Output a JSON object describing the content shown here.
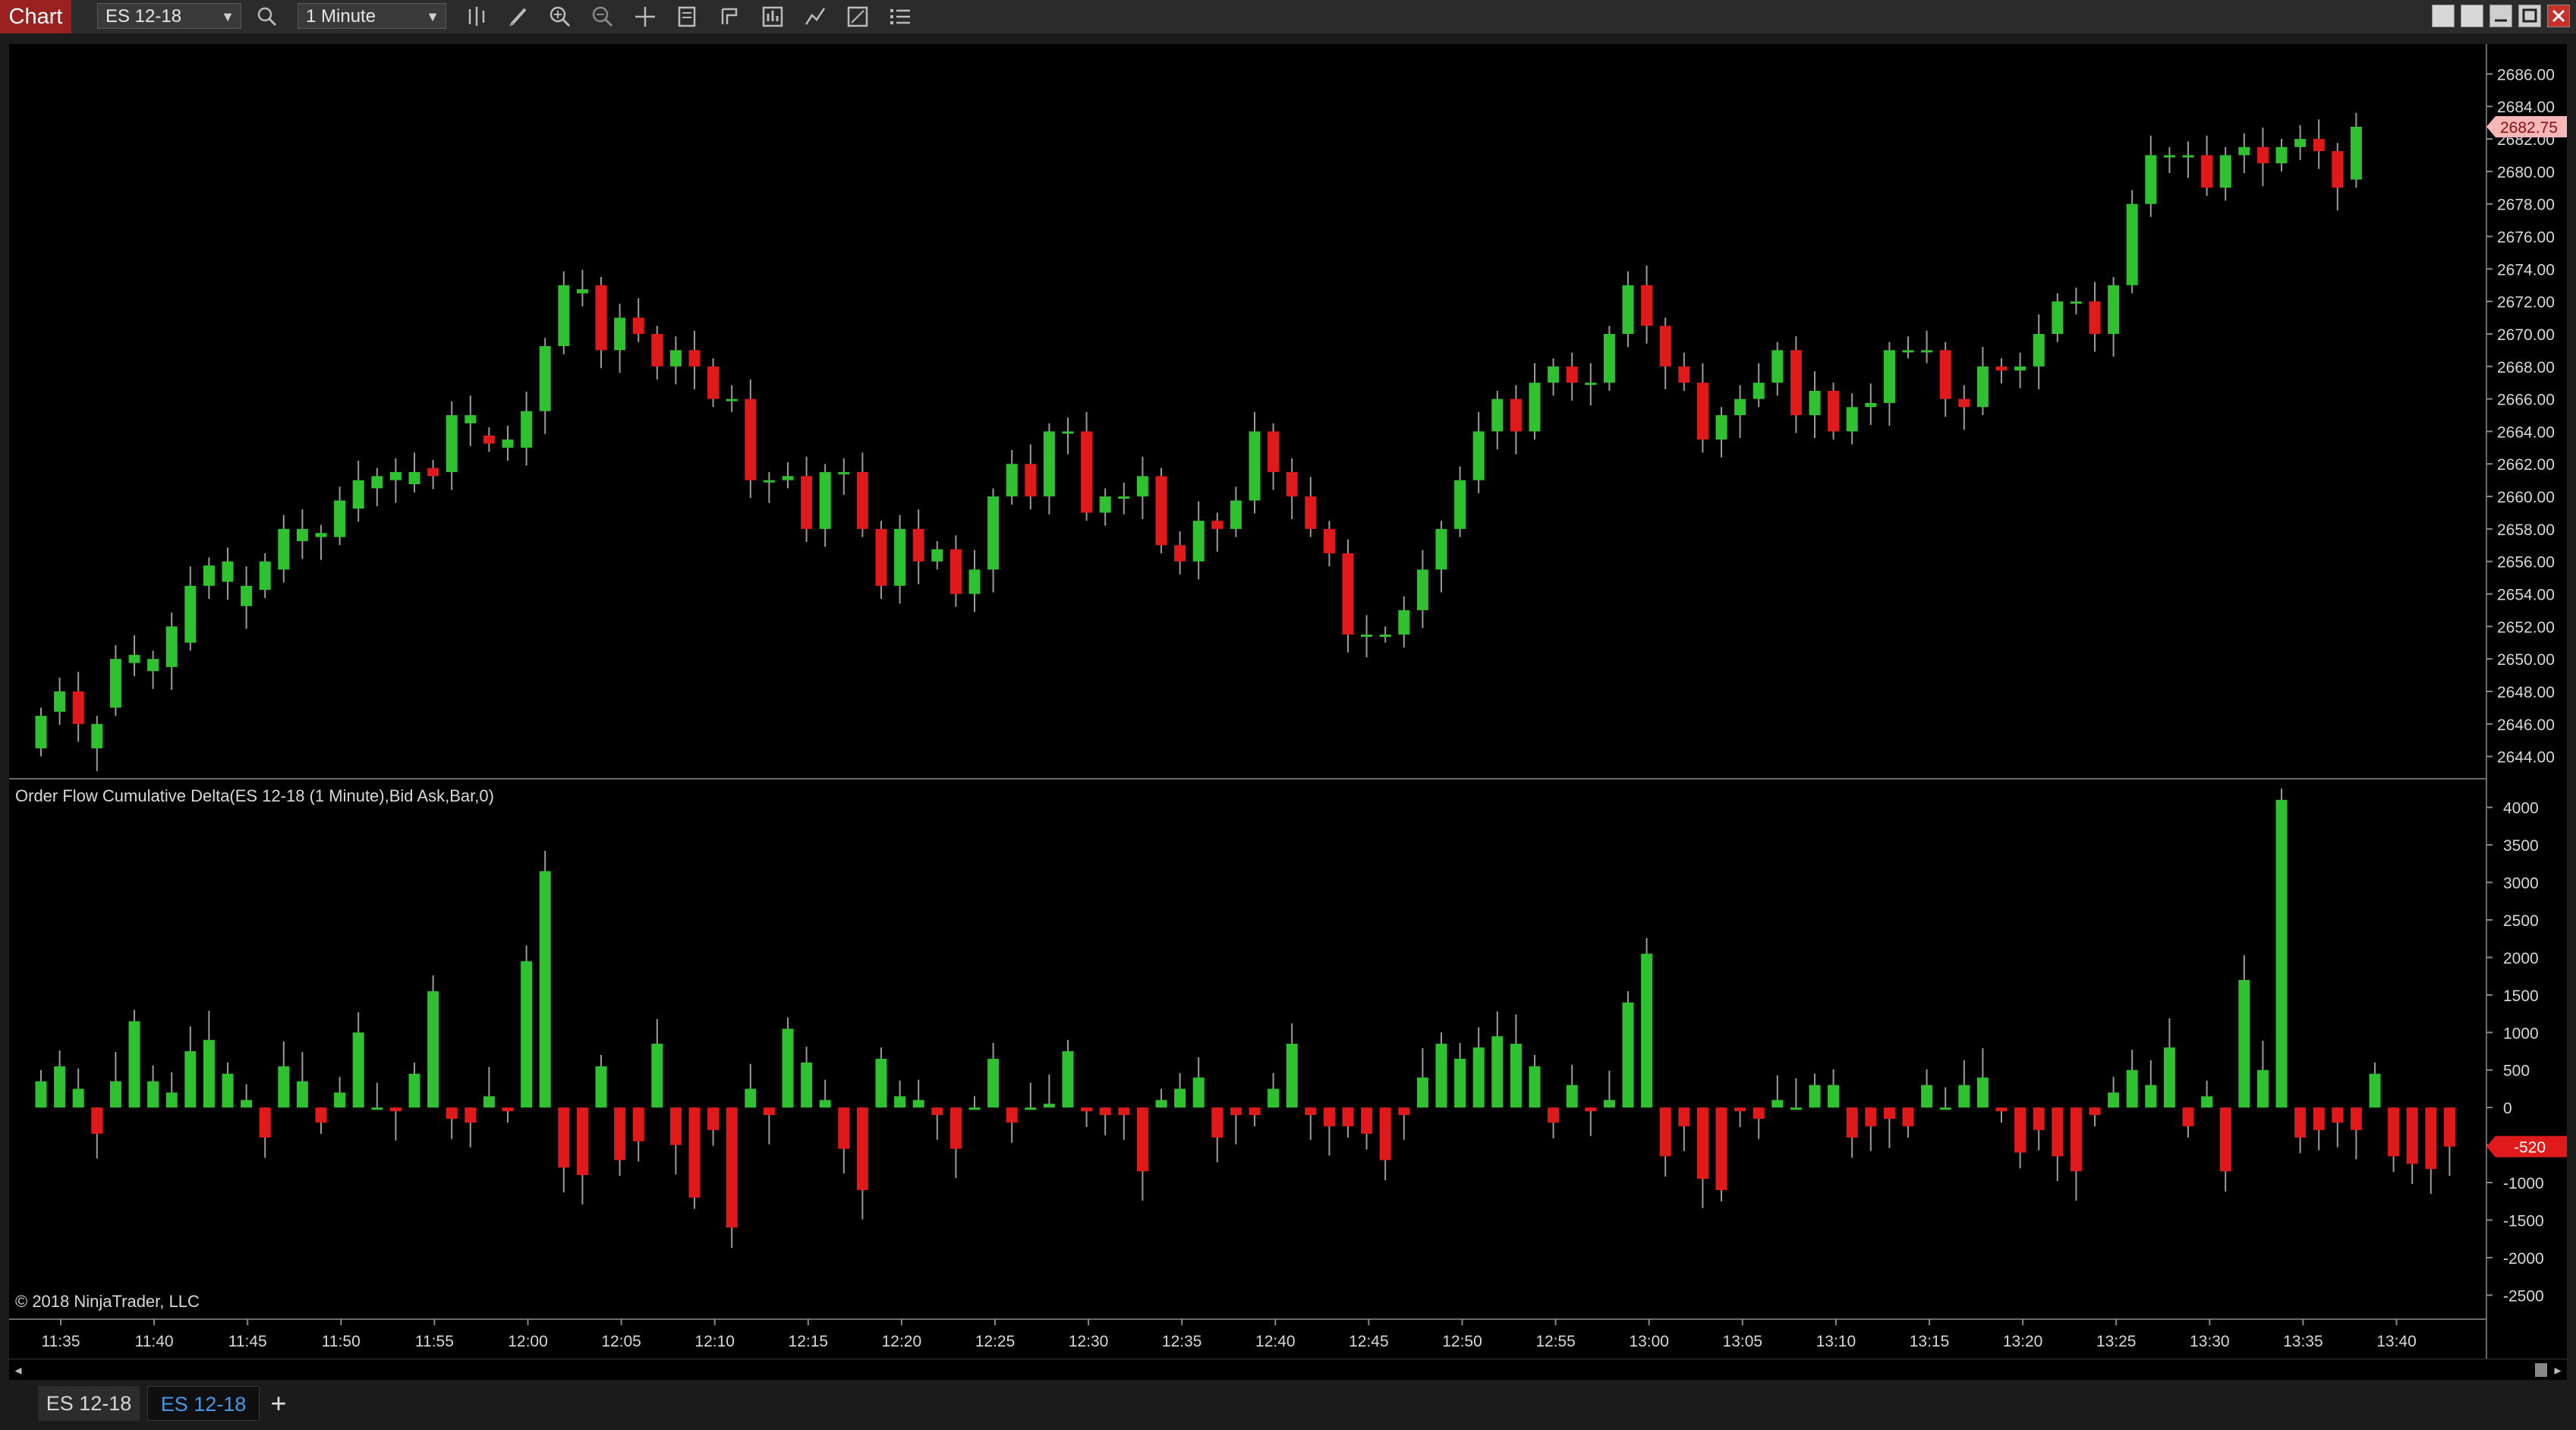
{
  "toolbar": {
    "chart_tab": "Chart",
    "instrument": "ES 12-18",
    "interval": "1 Minute",
    "icons": [
      "search-icon",
      "bar-type-icon",
      "pencil-icon",
      "zoom-in-icon",
      "zoom-out-icon",
      "crosshair-icon",
      "data-box-icon",
      "strategies-icon",
      "indicators-icon",
      "drawing-tools-icon",
      "properties-icon",
      "menu-list-icon"
    ],
    "window_buttons": [
      "tile-icon",
      "restore-icon",
      "minimize-icon",
      "maximize-icon",
      "close-icon"
    ]
  },
  "price_panel": {
    "y_ticks": [
      "2686.00",
      "2684.00",
      "2682.00",
      "2680.00",
      "2678.00",
      "2676.00",
      "2674.00",
      "2672.00",
      "2670.00",
      "2668.00",
      "2666.00",
      "2664.00",
      "2662.00",
      "2660.00",
      "2658.00",
      "2656.00",
      "2654.00",
      "2652.00",
      "2650.00",
      "2648.00",
      "2646.00",
      "2644.00"
    ],
    "last_price_label": "2682.75",
    "last_price": 2682.75,
    "colors": {
      "up": "#2fc12f",
      "down": "#e0191b",
      "last_price_bg": "#f5b7b7"
    }
  },
  "delta_panel": {
    "title": "Order Flow Cumulative Delta(ES 12-18 (1 Minute),Bid Ask,Bar,0)",
    "y_ticks": [
      "4000",
      "3500",
      "3000",
      "2500",
      "2000",
      "1500",
      "1000",
      "500",
      "0",
      "-500",
      "-1000",
      "-1500",
      "-2000",
      "-2500"
    ],
    "last_value_label": "-520",
    "last_value": -520,
    "copyright": "© 2018 NinjaTrader, LLC"
  },
  "x_ticks": [
    "11:35",
    "11:40",
    "11:45",
    "11:50",
    "11:55",
    "12:00",
    "12:05",
    "12:10",
    "12:15",
    "12:20",
    "12:25",
    "12:30",
    "12:35",
    "12:40",
    "12:45",
    "12:50",
    "12:55",
    "13:00",
    "13:05",
    "13:10",
    "13:15",
    "13:20",
    "13:25",
    "13:30",
    "13:35",
    "13:40"
  ],
  "tabs": [
    "ES 12-18",
    "ES 12-18"
  ],
  "add_tab": "+",
  "chart_data": [
    {
      "type": "candlestick",
      "start_time": "11:34",
      "interval_minutes": 1,
      "closes": [
        2646.5,
        2648,
        2646,
        2646,
        2650,
        2650.25,
        2650,
        2652,
        2654.5,
        2655.75,
        2656,
        2654.5,
        2656,
        2658,
        2658,
        2657.75,
        2659.75,
        2661,
        2661.25,
        2661.5,
        2661.5,
        2661.25,
        2665,
        2665,
        2663.25,
        2663.5,
        2665.25,
        2669.25,
        2673,
        2672.75,
        2669,
        2671,
        2670,
        2668,
        2669,
        2668,
        2666,
        2666,
        2661,
        2661,
        2661.25,
        2658,
        2661.5,
        2661.5,
        2658,
        2654.5,
        2658,
        2656,
        2656.75,
        2654,
        2655.5,
        2660,
        2662,
        2660,
        2664,
        2664,
        2659,
        2660,
        2660,
        2661.25,
        2657,
        2656,
        2658.5,
        2658,
        2659.75,
        2664,
        2661.5,
        2660,
        2658,
        2656.5,
        2651.5,
        2651.5,
        2651.5,
        2653,
        2655.5,
        2658,
        2661,
        2664,
        2666,
        2664,
        2667,
        2668,
        2667,
        2667,
        2670,
        2673,
        2670.5,
        2668,
        2667,
        2663.5,
        2665,
        2666,
        2667,
        2669,
        2665,
        2666.5,
        2664,
        2665.5,
        2665.75,
        2669,
        2669,
        2669,
        2666,
        2665.5,
        2668,
        2667.75,
        2668,
        2670,
        2672,
        2672,
        2670,
        2673,
        2678,
        2681,
        2681,
        2681,
        2679,
        2681,
        2681.5,
        2680.5,
        2681.5,
        2682,
        2681.25,
        2679,
        2682.75
      ],
      "opens": [
        2644.5,
        2646.75,
        2648,
        2644.5,
        2647,
        2649.75,
        2649.25,
        2649.5,
        2651,
        2654.5,
        2654.75,
        2653.25,
        2654.25,
        2655.5,
        2657.25,
        2657.5,
        2657.5,
        2659.25,
        2660.5,
        2661,
        2660.75,
        2661.75,
        2661.5,
        2664.5,
        2663.75,
        2663,
        2663,
        2665.25,
        2669.25,
        2672.5,
        2673,
        2669,
        2671,
        2670,
        2668,
        2669,
        2668,
        2666,
        2666,
        2661,
        2661,
        2661.25,
        2658,
        2661.5,
        2661.5,
        2658,
        2654.5,
        2658,
        2656,
        2656.75,
        2654,
        2655.5,
        2660,
        2662,
        2660,
        2664,
        2664,
        2659,
        2660,
        2660,
        2661.25,
        2657,
        2656,
        2658.5,
        2658,
        2659.75,
        2664,
        2661.5,
        2660,
        2658,
        2656.5,
        2651.5,
        2651.5,
        2651.5,
        2653,
        2655.5,
        2658,
        2661,
        2664,
        2666,
        2664,
        2667,
        2668,
        2667,
        2667,
        2670,
        2673,
        2670.5,
        2668,
        2667,
        2663.5,
        2665,
        2666,
        2667,
        2669,
        2665,
        2666.5,
        2664,
        2665.5,
        2665.75,
        2669,
        2669,
        2669,
        2666,
        2665.5,
        2668,
        2667.75,
        2668,
        2670,
        2672,
        2672,
        2670,
        2673,
        2678,
        2681,
        2681,
        2681,
        2679,
        2681,
        2681.5,
        2680.5,
        2681.5,
        2682,
        2681.25,
        2679.5
      ],
      "x_axis": [
        "11:35",
        "11:40",
        "11:45",
        "11:50",
        "11:55",
        "12:00",
        "12:05",
        "12:10",
        "12:15",
        "12:20",
        "12:25",
        "12:30",
        "12:35",
        "12:40",
        "12:45",
        "12:50",
        "12:55",
        "13:00",
        "13:05",
        "13:10",
        "13:15",
        "13:20",
        "13:25",
        "13:30",
        "13:35",
        "13:40"
      ],
      "ylim": [
        2643,
        2687
      ]
    },
    {
      "type": "bar",
      "title": "Order Flow Cumulative Delta(ES 12-18 (1 Minute),Bid Ask,Bar,0)",
      "values": [
        350,
        550,
        250,
        -350,
        350,
        1150,
        350,
        200,
        750,
        900,
        450,
        100,
        -400,
        550,
        350,
        -200,
        200,
        1000,
        0,
        -50,
        450,
        1550,
        -150,
        -200,
        150,
        -50,
        1950,
        3150,
        -800,
        -900,
        550,
        -700,
        -450,
        850,
        -500,
        -1200,
        -300,
        -1600,
        250,
        -100,
        1050,
        600,
        100,
        -550,
        -1100,
        650,
        150,
        100,
        -100,
        -550,
        0,
        650,
        -200,
        0,
        50,
        750,
        -50,
        -100,
        -100,
        -850,
        100,
        250,
        400,
        -400,
        -100,
        -100,
        250,
        850,
        -100,
        -250,
        -250,
        -350,
        -700,
        -100,
        400,
        850,
        650,
        800,
        950,
        850,
        550,
        -200,
        300,
        -50,
        100,
        1400,
        2050,
        -650,
        -250,
        -950,
        -1100,
        -50,
        -150,
        100,
        0,
        300,
        300,
        -400,
        -250,
        -150,
        -250,
        300,
        0,
        300,
        400,
        -50,
        -600,
        -300,
        -650,
        -850,
        -100,
        200,
        500,
        300,
        800,
        -250,
        150,
        -850,
        1700,
        500,
        4100,
        -400,
        -300,
        -200,
        -300,
        450,
        -650,
        -750,
        -820,
        -520
      ],
      "ylim": [
        -2800,
        4300
      ]
    }
  ]
}
